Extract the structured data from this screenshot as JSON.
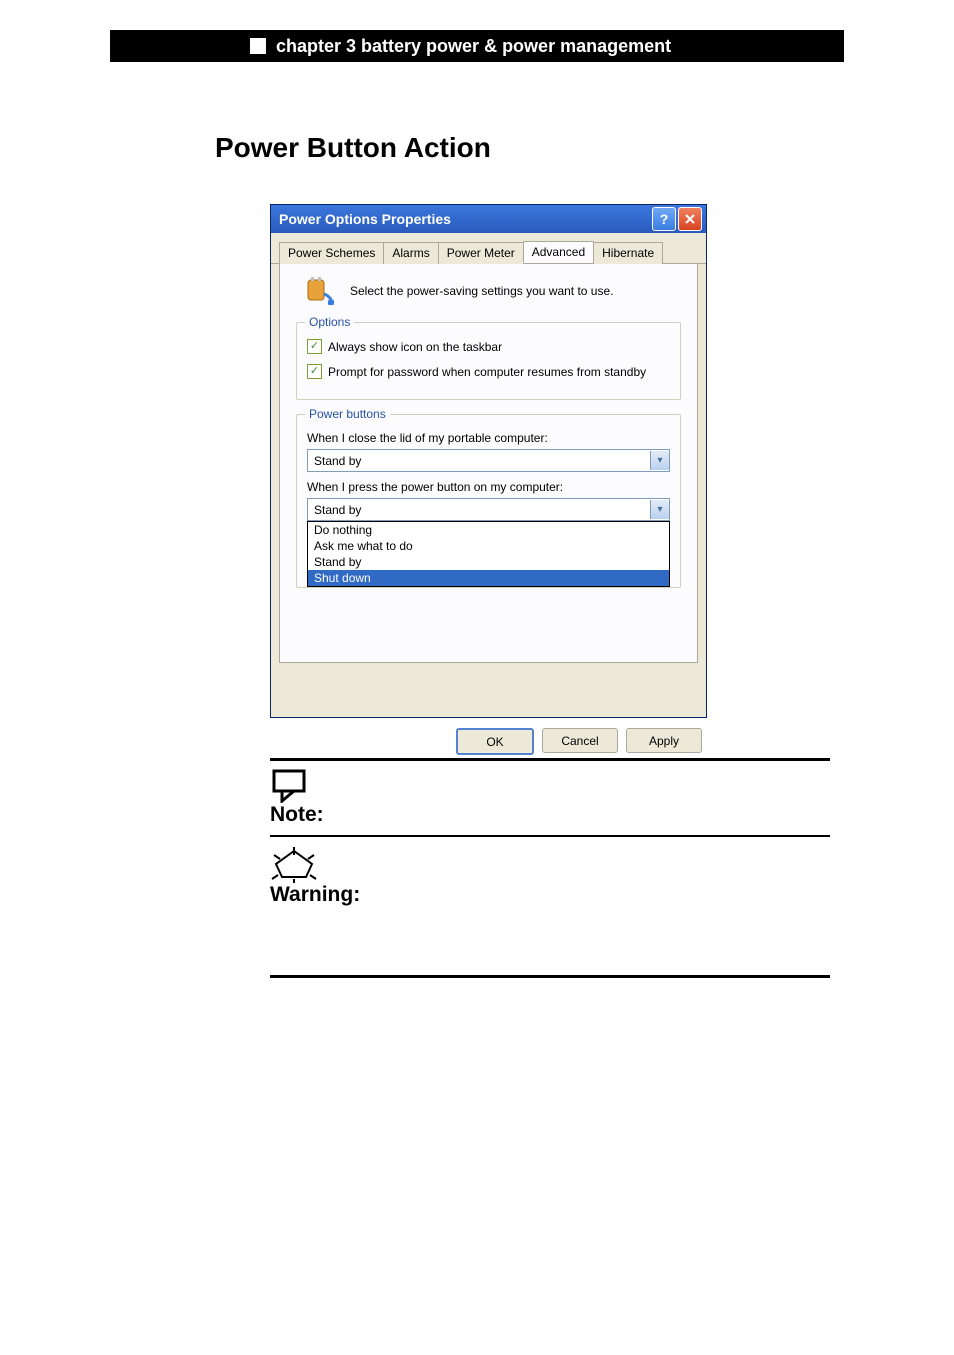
{
  "header": {
    "chapter_text": "chapter 3 battery power & power management"
  },
  "section": {
    "title": "Power Button Action"
  },
  "dialog": {
    "title": "Power Options Properties",
    "tabs": [
      "Power Schemes",
      "Alarms",
      "Power Meter",
      "Advanced",
      "Hibernate"
    ],
    "active_tab_index": 3,
    "intro": "Select the power-saving settings you want to use.",
    "options_group": {
      "legend": "Options",
      "cb1": "Always show icon on the taskbar",
      "cb2": "Prompt for password when computer resumes from standby"
    },
    "power_buttons_group": {
      "legend": "Power buttons",
      "lid_label": "When I close the lid of my portable computer:",
      "lid_value": "Stand by",
      "pwr_label": "When I press the power button on my computer:",
      "pwr_value": "Stand by",
      "options": [
        "Do nothing",
        "Ask me what to do",
        "Stand by",
        "Shut down"
      ],
      "selected_option_index": 3
    },
    "buttons": {
      "ok": "OK",
      "cancel": "Cancel",
      "apply": "Apply"
    }
  },
  "notes": {
    "note_label": "Note:",
    "warning_label": "Warning:"
  }
}
